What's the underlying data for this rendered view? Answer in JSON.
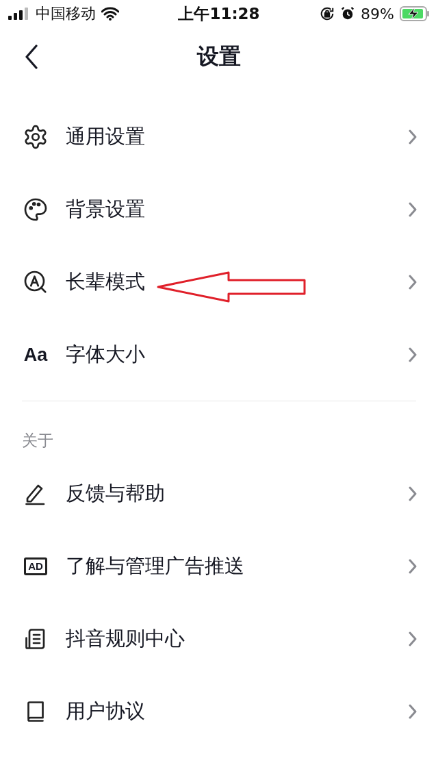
{
  "status_bar": {
    "carrier": "中国移动",
    "time": "上午11:28",
    "battery": "89%"
  },
  "header": {
    "title": "设置"
  },
  "groups": [
    {
      "items": [
        {
          "kind": "gear",
          "label": "通用设置"
        },
        {
          "kind": "palette",
          "label": "背景设置"
        },
        {
          "kind": "elder",
          "label": "长辈模式",
          "annotation": {
            "kind": "arrow"
          }
        },
        {
          "kind": "text",
          "icon_text": "Aa",
          "label": "字体大小"
        }
      ]
    },
    {
      "title": "关于",
      "items": [
        {
          "kind": "pencil",
          "label": "反馈与帮助"
        },
        {
          "kind": "badge",
          "icon_text": "AD",
          "label": "了解与管理广告推送"
        },
        {
          "kind": "document",
          "label": "抖音规则中心"
        },
        {
          "kind": "book",
          "label": "用户协议"
        }
      ]
    }
  ]
}
